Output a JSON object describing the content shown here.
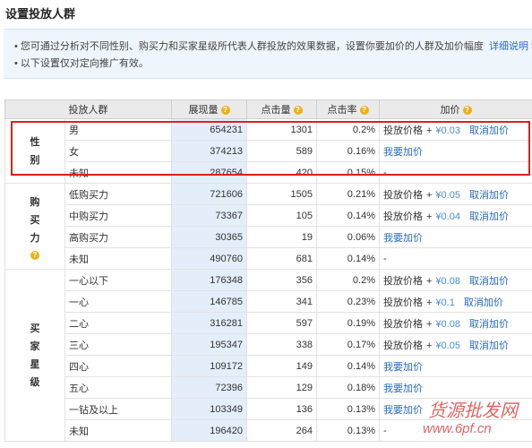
{
  "page": {
    "title": "设置投放人群",
    "notice_line1": "您可通过分析对不同性别、购买力和买家星级所代表人群投放的效果数据，设置你要加价的人群及加价幅度",
    "notice_line2": "以下设置仅对定向推广有效。",
    "more_link": "详细说明 >"
  },
  "table": {
    "headers": {
      "group": "投放人群",
      "impressions": "展现量",
      "clicks": "点击量",
      "ctr": "点击率",
      "bid": "加价"
    },
    "help_icon": "question-icon",
    "price_label": "投放价格",
    "plus": "+",
    "cancel_label": "取消加价",
    "want_label": "我要加价",
    "dash": "-",
    "groups": [
      {
        "name_chars": [
          "性",
          "别"
        ],
        "help": false,
        "rows": [
          {
            "label": "男",
            "impressions": "654231",
            "clicks": "1301",
            "ctr": "0.2%",
            "price": "¥0.03",
            "state": "priced"
          },
          {
            "label": "女",
            "impressions": "374213",
            "clicks": "589",
            "ctr": "0.16%",
            "state": "want"
          },
          {
            "label": "未知",
            "impressions": "287654",
            "clicks": "420",
            "ctr": "0.15%",
            "state": "none"
          }
        ]
      },
      {
        "name_chars": [
          "购",
          "买",
          "力"
        ],
        "help": true,
        "rows": [
          {
            "label": "低购买力",
            "impressions": "721606",
            "clicks": "1505",
            "ctr": "0.21%",
            "price": "¥0.05",
            "state": "priced"
          },
          {
            "label": "中购买力",
            "impressions": "73367",
            "clicks": "105",
            "ctr": "0.14%",
            "price": "¥0.04",
            "state": "priced"
          },
          {
            "label": "高购买力",
            "impressions": "30365",
            "clicks": "19",
            "ctr": "0.06%",
            "state": "want"
          },
          {
            "label": "未知",
            "impressions": "490760",
            "clicks": "681",
            "ctr": "0.14%",
            "state": "none"
          }
        ]
      },
      {
        "name_chars": [
          "买",
          "家",
          "星",
          "级"
        ],
        "help": false,
        "rows": [
          {
            "label": "一心以下",
            "impressions": "176348",
            "clicks": "356",
            "ctr": "0.2%",
            "price": "¥0.08",
            "state": "priced"
          },
          {
            "label": "一心",
            "impressions": "146785",
            "clicks": "341",
            "ctr": "0.23%",
            "price": "¥0.1",
            "state": "priced"
          },
          {
            "label": "二心",
            "impressions": "316281",
            "clicks": "597",
            "ctr": "0.19%",
            "price": "¥0.08",
            "state": "priced"
          },
          {
            "label": "三心",
            "impressions": "195347",
            "clicks": "338",
            "ctr": "0.17%",
            "price": "¥0.05",
            "state": "priced"
          },
          {
            "label": "四心",
            "impressions": "109172",
            "clicks": "149",
            "ctr": "0.14%",
            "state": "want"
          },
          {
            "label": "五心",
            "impressions": "72396",
            "clicks": "129",
            "ctr": "0.18%",
            "state": "want"
          },
          {
            "label": "一钻及以上",
            "impressions": "103349",
            "clicks": "136",
            "ctr": "0.13%",
            "state": "want"
          },
          {
            "label": "未知",
            "impressions": "196420",
            "clicks": "264",
            "ctr": "0.13%",
            "state": "none"
          }
        ]
      }
    ]
  },
  "watermark": {
    "line1": "货源批发网",
    "line2": "www.6pf.cn"
  },
  "colors": {
    "highlight_box": "#e01f1f",
    "link": "#2a6cc4",
    "price": "#4a90d6",
    "impressions_bg": "#e3eefa",
    "help_icon": "#e9b21a"
  }
}
